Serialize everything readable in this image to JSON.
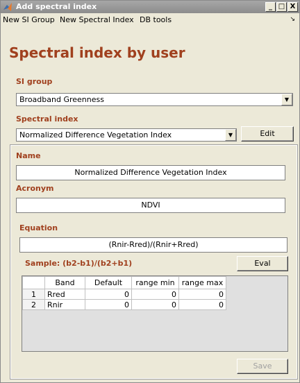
{
  "window": {
    "title": "Add spectral index",
    "controls": {
      "minimize": "_",
      "maximize": "□",
      "close": "X"
    }
  },
  "menubar": {
    "items": [
      "New SI Group",
      "New Spectral Index",
      "DB tools"
    ],
    "overflow_icon": "arrow-icon"
  },
  "heading": "Spectral index by user",
  "si_group": {
    "label": "SI group",
    "value": "Broadband Greenness"
  },
  "spectral_index": {
    "label": "Spectral index",
    "value": "Normalized Difference Vegetation Index",
    "edit_label": "Edit"
  },
  "details": {
    "name_label": "Name",
    "name_value": "Normalized Difference Vegetation Index",
    "acronym_label": "Acronym",
    "acronym_value": "NDVI",
    "equation_label": "Equation",
    "equation_value": "(Rnir-Rred)/(Rnir+Rred)",
    "sample_label": "Sample: (b2-b1)/(b2+b1)",
    "eval_label": "Eval",
    "save_label": "Save"
  },
  "bands_table": {
    "columns": [
      "",
      "Band",
      "Default",
      "range min",
      "range max"
    ],
    "rows": [
      [
        "1",
        "Rred",
        "0",
        "0",
        "0"
      ],
      [
        "2",
        "Rnir",
        "0",
        "0",
        "0"
      ]
    ]
  }
}
